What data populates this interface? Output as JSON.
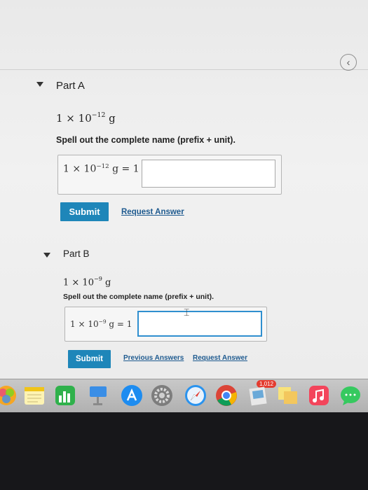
{
  "part_a": {
    "title": "Part A",
    "quantity_base": "1 × 10",
    "quantity_exp": "−12",
    "quantity_unit": " g",
    "instruction": "Spell out the complete name (prefix + unit).",
    "eq_base": "1 × 10",
    "eq_exp": "−12",
    "eq_rest": " g = 1",
    "input_value": "",
    "submit_label": "Submit",
    "request_label": "Request Answer"
  },
  "part_b": {
    "title": "Part B",
    "quantity_base": "1 × 10",
    "quantity_exp": "−9",
    "quantity_unit": " g",
    "instruction": "Spell out the complete name (prefix + unit).",
    "eq_base": "1 × 10",
    "eq_exp": "−9",
    "eq_rest": " g = 1",
    "input_value": "",
    "submit_label": "Submit",
    "previous_label": "Previous Answers",
    "request_label": "Request Answer"
  },
  "dock": {
    "badge_count": "1,012",
    "icons": [
      "photos-icon",
      "notes-icon",
      "numbers-icon",
      "keynote-icon",
      "app-store-icon",
      "system-preferences-icon",
      "safari-icon",
      "chrome-icon",
      "preview-icon",
      "stickies-icon",
      "music-icon",
      "messages-icon"
    ]
  },
  "colors": {
    "accent": "#1e86b9",
    "link": "#1e5a8f",
    "active_input_border": "#2f8fcf"
  }
}
